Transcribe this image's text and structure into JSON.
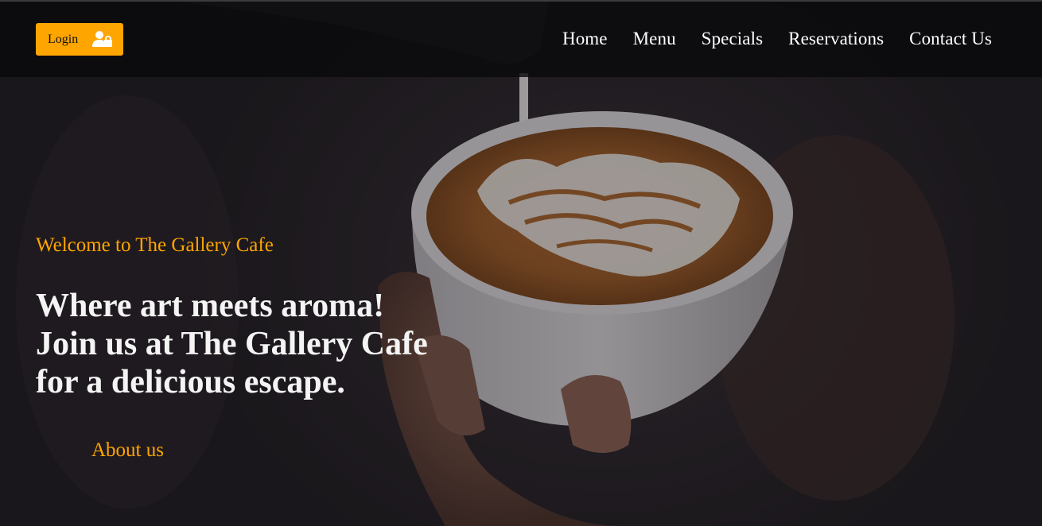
{
  "header": {
    "login_label": "Login",
    "login_icon": "user-lock-icon",
    "nav": [
      "Home",
      "Menu",
      "Specials",
      "Reservations",
      "Contact Us"
    ]
  },
  "hero": {
    "welcome": "Welcome to The Gallery Cafe",
    "headline": "Where art meets aroma! Join us at The Gallery Cafe for a delicious escape.",
    "about_label": "About us",
    "background_image": "latte-art-coffee-cup-photo"
  },
  "colors": {
    "accent": "#ffa500",
    "topbar": "#0a0a0c",
    "text": "#ffffff"
  }
}
